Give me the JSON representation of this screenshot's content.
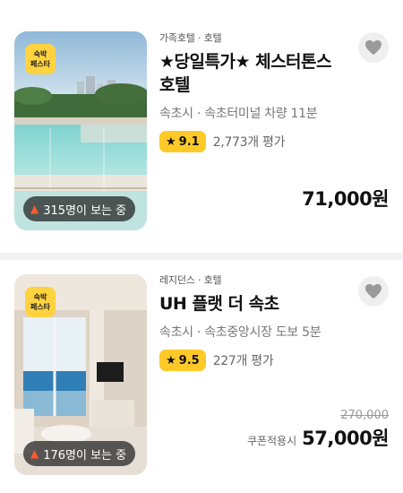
{
  "listings": [
    {
      "category": "가족호텔 · 호텔",
      "name": "★당일특가★ 체스터톤스 호텔",
      "location": "속초시 · 속초터미널 차량 11분",
      "rating": "9.1",
      "reviews": "2,773개 평가",
      "badge_line1": "숙박",
      "badge_line2": "페스타",
      "viewers": "315명이 보는 중",
      "original_price": "",
      "coupon_label": "",
      "price": "71,000원",
      "image_icon": "hotel-pool-photo"
    },
    {
      "category": "레지던스 · 호텔",
      "name": "UH 플랫 더 속초",
      "location": "속초시 · 속초중앙시장 도보 5분",
      "rating": "9.5",
      "reviews": "227개 평가",
      "badge_line1": "숙박",
      "badge_line2": "페스타",
      "viewers": "176명이 보는 중",
      "original_price": "270,000",
      "coupon_label": "쿠폰적용시",
      "price": "57,000원",
      "image_icon": "hotel-room-photo"
    }
  ],
  "colors": {
    "badge_yellow": "#ffd23f",
    "rating_yellow": "#ffc928",
    "divider": "#f2f3f5"
  }
}
